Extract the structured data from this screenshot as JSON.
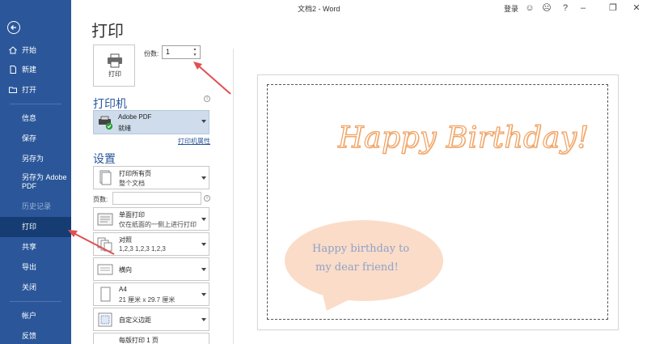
{
  "window": {
    "title": "文档2  -  Word",
    "login_label": "登录"
  },
  "sidebar": {
    "items": [
      {
        "label": "开始",
        "icon": "home-icon"
      },
      {
        "label": "新建",
        "icon": "new-document-icon"
      },
      {
        "label": "打开",
        "icon": "open-folder-icon"
      },
      {
        "label": "信息"
      },
      {
        "label": "保存"
      },
      {
        "label": "另存为"
      },
      {
        "label": "另存为 Adobe PDF"
      },
      {
        "label": "历史记录",
        "disabled": true
      },
      {
        "label": "打印",
        "active": true
      },
      {
        "label": "共享"
      },
      {
        "label": "导出"
      },
      {
        "label": "关闭"
      },
      {
        "label": "帐户"
      },
      {
        "label": "反馈"
      }
    ]
  },
  "print": {
    "heading": "打印",
    "print_button_label": "打印",
    "copies_label": "份数:",
    "copies_value": "1",
    "printer_section_title": "打印机",
    "printer_name": "Adobe PDF",
    "printer_status": "就绪",
    "printer_properties_link": "打印机属性",
    "settings_section_title": "设置",
    "pages_label": "页数:",
    "pages_value": "",
    "settings": [
      {
        "line1": "打印所有页",
        "line2": "整个文档"
      },
      {
        "line1": "单面打印",
        "line2": "仅在纸面的一侧上进行打印"
      },
      {
        "line1": "对照",
        "line2": "1,2,3     1,2,3     1,2,3"
      },
      {
        "line1": "横向",
        "line2": ""
      },
      {
        "line1": "A4",
        "line2": "21 厘米 x 29.7 厘米"
      },
      {
        "line1": "自定义边距",
        "line2": ""
      },
      {
        "line1": "每版打印 1 页",
        "line2": ""
      }
    ]
  },
  "preview": {
    "headline": "Happy Birthday!",
    "bubble_line1": "Happy birthday to",
    "bubble_line2": "my dear friend!"
  },
  "colors": {
    "sidebar_bg": "#2b579a",
    "sidebar_active": "#163d73",
    "accent": "#2b579a",
    "headline_outline": "#f0a060",
    "bubble_fill": "#fbdcc8",
    "bubble_text": "#8ea2c9",
    "annotation_arrow": "#e05050"
  }
}
